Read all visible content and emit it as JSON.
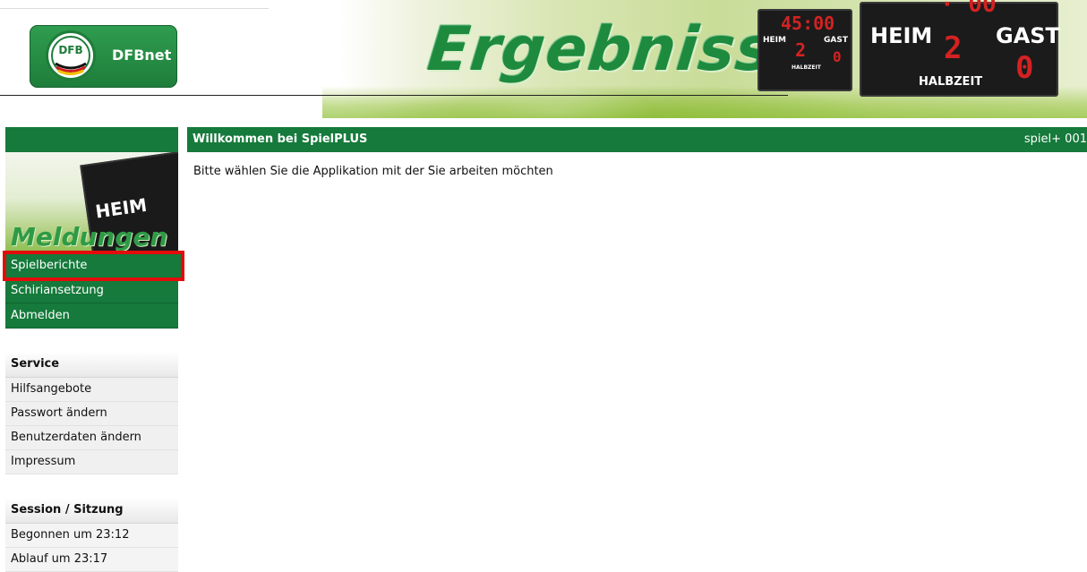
{
  "header": {
    "logo_text": "DFBnet",
    "logo_emblem": "DFB",
    "banner_title": "Ergebnisse",
    "scoreboard_small": {
      "time": "45:00",
      "home": "HEIM",
      "away": "GAST",
      "home_score": "2",
      "away_score": "0",
      "period": "HALBZEIT"
    },
    "scoreboard_big": {
      "home": "HEIM",
      "away": "GAST",
      "home_score": "2",
      "away_score": "0",
      "period": "HALBZEIT"
    }
  },
  "sidebar": {
    "section_title": "Meldungen",
    "mini_board_label": "HEIM",
    "menu": [
      {
        "label": "Spielberichte",
        "selected": true
      },
      {
        "label": "Schiriansetzung"
      },
      {
        "label": "Abmelden"
      }
    ],
    "service": {
      "title": "Service",
      "items": [
        "Hilfsangebote",
        "Passwort ändern",
        "Benutzerdaten ändern",
        "Impressum"
      ]
    },
    "session": {
      "title": "Session / Sitzung",
      "items": [
        "Begonnen um 23:12",
        "Ablauf um 23:17"
      ]
    }
  },
  "main": {
    "title": "Willkommen bei SpielPLUS",
    "code": "spiel+ 001",
    "text": "Bitte wählen Sie die Applikation mit der Sie arbeiten möchten"
  },
  "colors": {
    "brand_green": "#157a3b",
    "highlight_red": "#e30b0b",
    "scoreboard_red": "#d32222"
  }
}
